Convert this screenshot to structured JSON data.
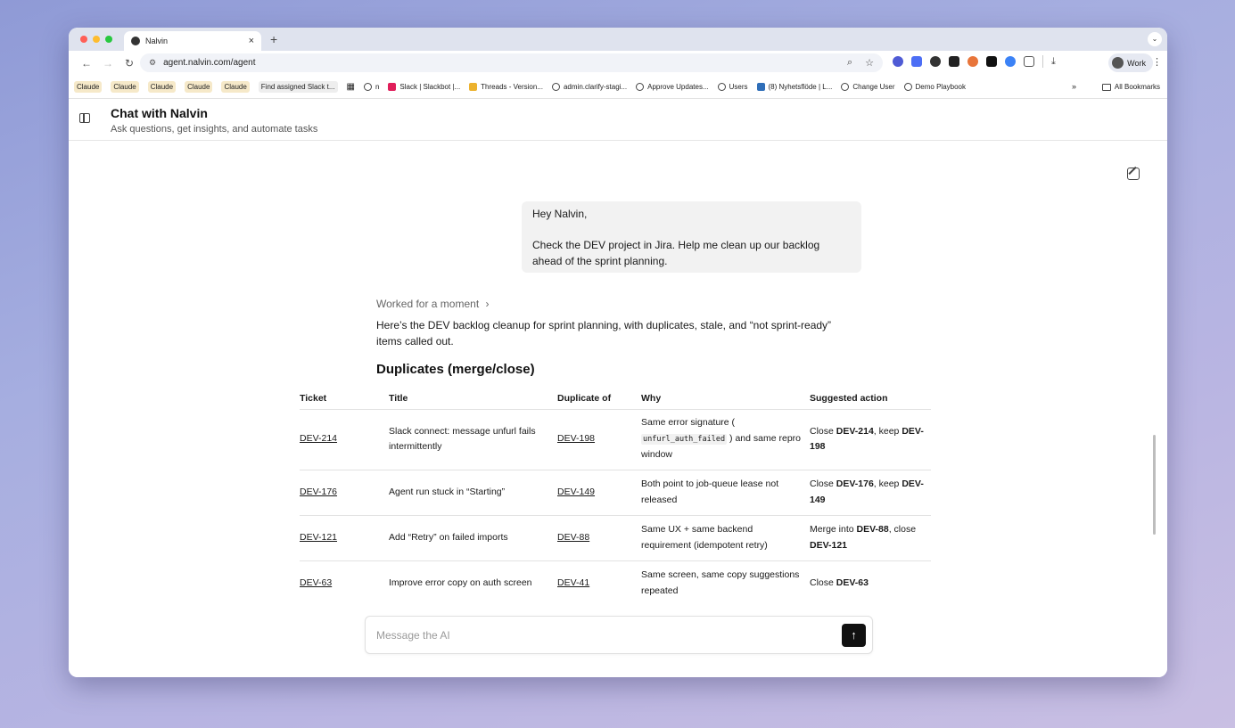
{
  "browser": {
    "tab_title": "Nalvin",
    "tab_close": "×",
    "new_tab": "+",
    "url": "agent.nalvin.com/agent",
    "profile_label": "Work",
    "bookmarks": [
      "Claude",
      "Claude",
      "Claude",
      "Claude",
      "Claude",
      "Find assigned Slack t...",
      "n",
      "Slack | Slackbot |...",
      "Threads - Version...",
      "admin.clarify-stagi...",
      "Approve Updates...",
      "Users",
      "(8) Nyhetsflöde | L...",
      "Change User",
      "Demo Playbook"
    ],
    "bookmarks_more": "»",
    "all_bookmarks": "All Bookmarks"
  },
  "header": {
    "title": "Chat with Nalvin",
    "subtitle": "Ask questions, get insights, and automate tasks"
  },
  "chat": {
    "user_message_line1": "Hey Nalvin,",
    "user_message_line2": "Check the DEV project in Jira. Help me clean up our backlog ahead of the sprint planning.",
    "worked_label": "Worked for a moment",
    "reply_intro": "Here’s the DEV backlog cleanup for sprint planning, with duplicates, stale, and “not sprint-ready” items called out.",
    "section_title": "Duplicates (merge/close)",
    "table": {
      "headers": [
        "Ticket",
        "Title",
        "Duplicate of",
        "Why",
        "Suggested action"
      ],
      "rows": [
        {
          "ticket": "DEV-214",
          "title": "Slack connect: message unfurl fails intermittently",
          "duplicate_of": "DEV-198",
          "why_pre": "Same error signature (",
          "why_code": "unfurl_auth_failed",
          "why_post": ") and same repro window",
          "action_pre": "Close ",
          "action_b1": "DEV-214",
          "action_mid": ", keep ",
          "action_b2": "DEV-198",
          "action_post": ""
        },
        {
          "ticket": "DEV-176",
          "title": "Agent run stuck in “Starting”",
          "duplicate_of": "DEV-149",
          "why": "Both point to job-queue lease not released",
          "action_pre": "Close ",
          "action_b1": "DEV-176",
          "action_mid": ", keep ",
          "action_b2": "DEV-149",
          "action_post": ""
        },
        {
          "ticket": "DEV-121",
          "title": "Add “Retry” on failed imports",
          "duplicate_of": "DEV-88",
          "why": "Same UX + same backend requirement (idempotent retry)",
          "action_pre": "Merge into ",
          "action_b1": "DEV-88",
          "action_mid": ", close ",
          "action_b2": "DEV-121",
          "action_post": ""
        },
        {
          "ticket": "DEV-63",
          "title": "Improve error copy on auth screen",
          "duplicate_of": "DEV-41",
          "why": "Same screen, same copy suggestions repeated",
          "action_pre": "Close ",
          "action_b1": "DEV-63"
        }
      ]
    }
  },
  "composer": {
    "placeholder": "Message the AI",
    "send_icon": "↑"
  },
  "colors": {
    "accent": "#111111",
    "user_bubble": "#f2f2f2",
    "light_red": "#ff5f57",
    "light_yellow": "#febc2e",
    "light_green": "#28c840"
  }
}
